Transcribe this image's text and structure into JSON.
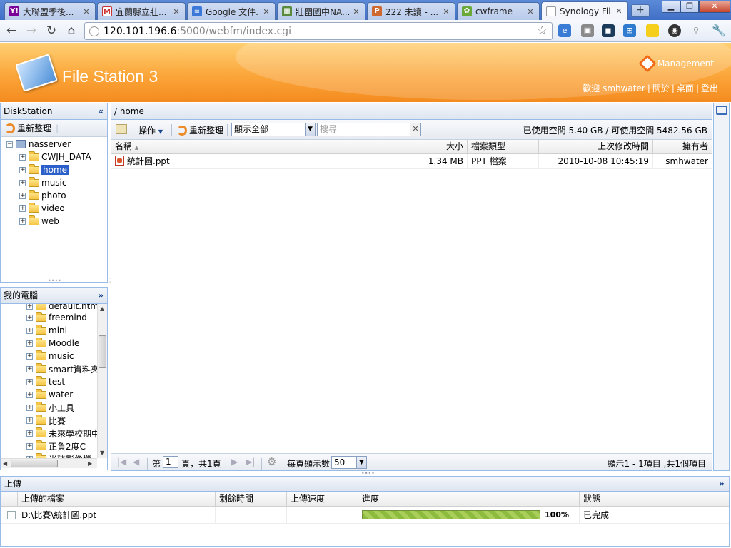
{
  "browser": {
    "tabs": [
      {
        "label": "大聯盟季後...",
        "icon": "yahoo-icon",
        "color": "#7b0099"
      },
      {
        "label": "宜蘭縣立壯...",
        "icon": "gmail-icon",
        "color": "#c33"
      },
      {
        "label": "Google 文件...",
        "icon": "google-docs-icon",
        "color": "#3c78d8"
      },
      {
        "label": "壯圍國中NA...",
        "icon": "grid-icon",
        "color": "#5a8a3c"
      },
      {
        "label": "222 未讀 - ...",
        "icon": "plurk-icon",
        "color": "#cf682f"
      },
      {
        "label": "cwframe",
        "icon": "cwframe-icon",
        "color": "#6aa83a"
      },
      {
        "label": "Synology Fil...",
        "icon": "page-icon",
        "color": "#ffffff"
      }
    ],
    "url_host": "120.101.196.6",
    "url_rest": ":5000/webfm/index.cgi"
  },
  "header": {
    "title": "File Station 3",
    "management": "Management",
    "welcome": "歡迎 smhwater",
    "links": [
      "關於",
      "桌面",
      "登出"
    ]
  },
  "diskstation": {
    "title": "DiskStation",
    "refresh": "重新整理",
    "root": "nasserver",
    "folders": [
      "CWJH_DATA",
      "home",
      "music",
      "photo",
      "video",
      "web"
    ],
    "selected": "home"
  },
  "mypc": {
    "title": "我的電腦",
    "folders": [
      "default.html_",
      "freemind",
      "mini",
      "Moodle",
      "music",
      "smart資料夾",
      "test",
      "water",
      "小工具",
      "比賽",
      "未來學校期中",
      "正負2度C",
      "光碟影像檔"
    ]
  },
  "main": {
    "path": "/ home",
    "actions": "操作",
    "refresh": "重新整理",
    "filter": "顯示全部",
    "search_placeholder": "搜尋",
    "space": "已使用空間 5.40 GB / 可使用空間 5482.56 GB",
    "columns": {
      "name": "名稱",
      "size": "大小",
      "type": "檔案類型",
      "modified": "上次修改時間",
      "owner": "擁有者"
    },
    "files": [
      {
        "name": "統計圖.ppt",
        "size": "1.34 MB",
        "type": "PPT 檔案",
        "modified": "2010-10-08 10:45:19",
        "owner": "smhwater"
      }
    ],
    "pager": {
      "page_prefix": "第",
      "page": "1",
      "page_suffix": "頁，共1頁",
      "per_page_label": "每頁顯示數",
      "per_page": "50",
      "summary": "顯示1 - 1項目 ,共1個項目"
    }
  },
  "upload": {
    "title": "上傳",
    "columns": {
      "file": "上傳的檔案",
      "remaining": "剩餘時間",
      "speed": "上傳速度",
      "progress": "進度",
      "status": "狀態"
    },
    "item": {
      "file": "D:\\比賽\\統計圖.ppt",
      "remaining": "",
      "speed": "",
      "progress_text": "100%",
      "progress": 1.0,
      "status": "已完成"
    }
  }
}
